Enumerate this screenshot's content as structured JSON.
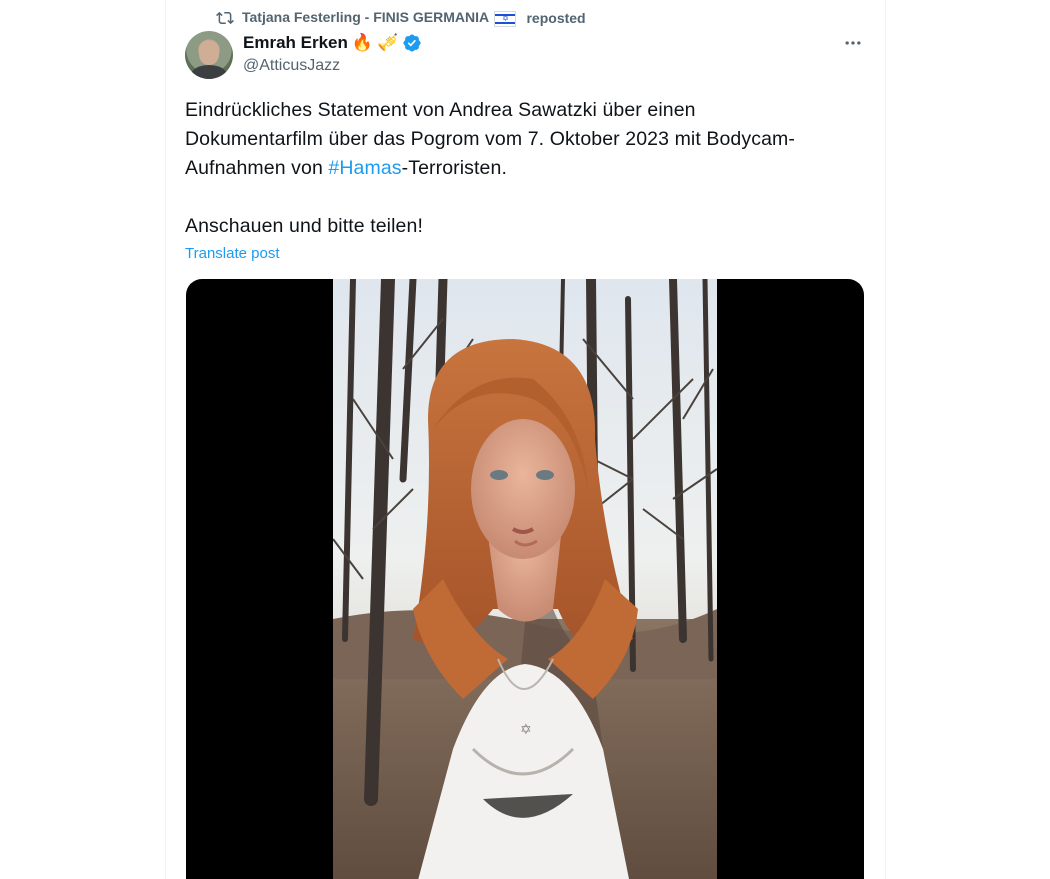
{
  "repost": {
    "icon": "repost-icon",
    "user_name": "Tatjana Festerling - FINIS GERMANIA",
    "flag": "israel-flag-icon",
    "action_text": "reposted"
  },
  "author": {
    "display_name": "Emrah Erken",
    "emojis": [
      "🔥",
      "🎺"
    ],
    "verified": true,
    "handle": "@AtticusJazz"
  },
  "post": {
    "line1": "Eindrückliches Statement von Andrea Sawatzki über einen",
    "line2": "Dokumentarfilm über das Pogrom vom 7. Oktober 2023 mit Bodycam-",
    "line3_before": "Aufnahmen von ",
    "line3_hashtag": "#Hamas",
    "line3_after": "-Terroristen.",
    "line4": "Anschauen und bitte teilen!",
    "translate_label": "Translate post"
  },
  "media": {
    "type": "video",
    "content": "woman-in-forest-video-frame"
  },
  "colors": {
    "text": "#0f1419",
    "secondary": "#536471",
    "link": "#1d9bf0",
    "verified": "#1d9bf0",
    "border": "#eff3f4"
  }
}
